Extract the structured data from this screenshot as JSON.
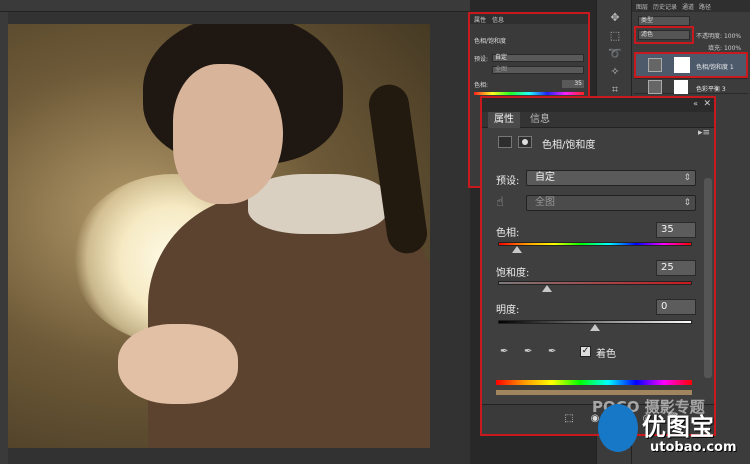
{
  "layers_panel": {
    "tabs": [
      "图层",
      "历史记录",
      "通道",
      "路径"
    ],
    "kind_label": "类型",
    "blend_mode": "滤色",
    "opacity_label": "不透明度:",
    "opacity_value": "100%",
    "fill_label": "填充:",
    "fill_value": "100%",
    "layers": [
      {
        "name": "色相/饱和度 1",
        "selected": true
      },
      {
        "name": "色彩平衡 3",
        "selected": false
      }
    ]
  },
  "small_properties": {
    "tabs": [
      "属性",
      "信息"
    ],
    "header": "色相/饱和度",
    "preset_label": "预设:",
    "preset_value": "自定",
    "channel_value": "全图",
    "hue_label": "色相:",
    "hue_value": "35"
  },
  "properties": {
    "tabs": [
      "属性",
      "信息"
    ],
    "active_tab": "属性",
    "header": "色相/饱和度",
    "preset_label": "预设:",
    "preset_value": "自定",
    "channel_value": "全图",
    "hue_label": "色相:",
    "hue_value": "35",
    "hue_level": 0.1,
    "saturation_label": "饱和度:",
    "saturation_value": "25",
    "saturation_level": 0.25,
    "lightness_label": "明度:",
    "lightness_value": "0",
    "lightness_level": 0.5,
    "colorize_label": "着色",
    "colorize_checked": true,
    "colorize_bar_color": "#a0855f"
  },
  "watermark": {
    "poco": "POCO 摄影专题",
    "brand": "优图宝",
    "url": "utobao.com"
  },
  "colors": {
    "highlight_border": "#c8191e",
    "panel_bg": "#3f3f3f"
  }
}
